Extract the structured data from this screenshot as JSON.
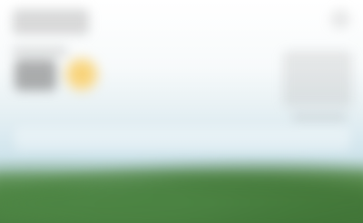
{
  "screen": {
    "description_visible_text": "",
    "icons": {
      "weather": "sun-icon"
    },
    "colors": {
      "sky_top": "#ffffff",
      "sky_mid": "#dcebf1",
      "foliage": "#4a7a3d",
      "sun": "#f7cd6b"
    }
  }
}
